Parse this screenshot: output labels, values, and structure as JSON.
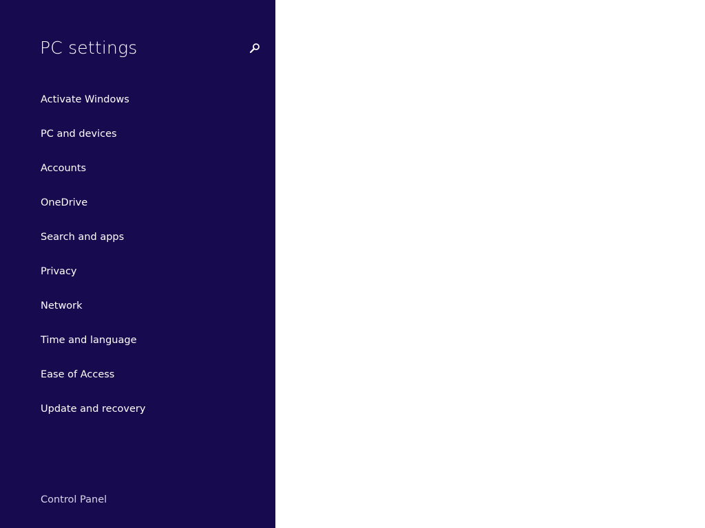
{
  "app": {
    "title": "PC settings"
  },
  "colors": {
    "sidebar_bg": "#180a4f",
    "main_bg": "#ffffff",
    "text": "#ffffff"
  },
  "header": {
    "search_icon": "search-icon"
  },
  "nav": {
    "items": [
      {
        "label": "Activate Windows"
      },
      {
        "label": "PC and devices"
      },
      {
        "label": "Accounts"
      },
      {
        "label": "OneDrive"
      },
      {
        "label": "Search and apps"
      },
      {
        "label": "Privacy"
      },
      {
        "label": "Network"
      },
      {
        "label": "Time and language"
      },
      {
        "label": "Ease of Access"
      },
      {
        "label": "Update and recovery"
      }
    ]
  },
  "footer": {
    "control_panel_label": "Control Panel"
  }
}
